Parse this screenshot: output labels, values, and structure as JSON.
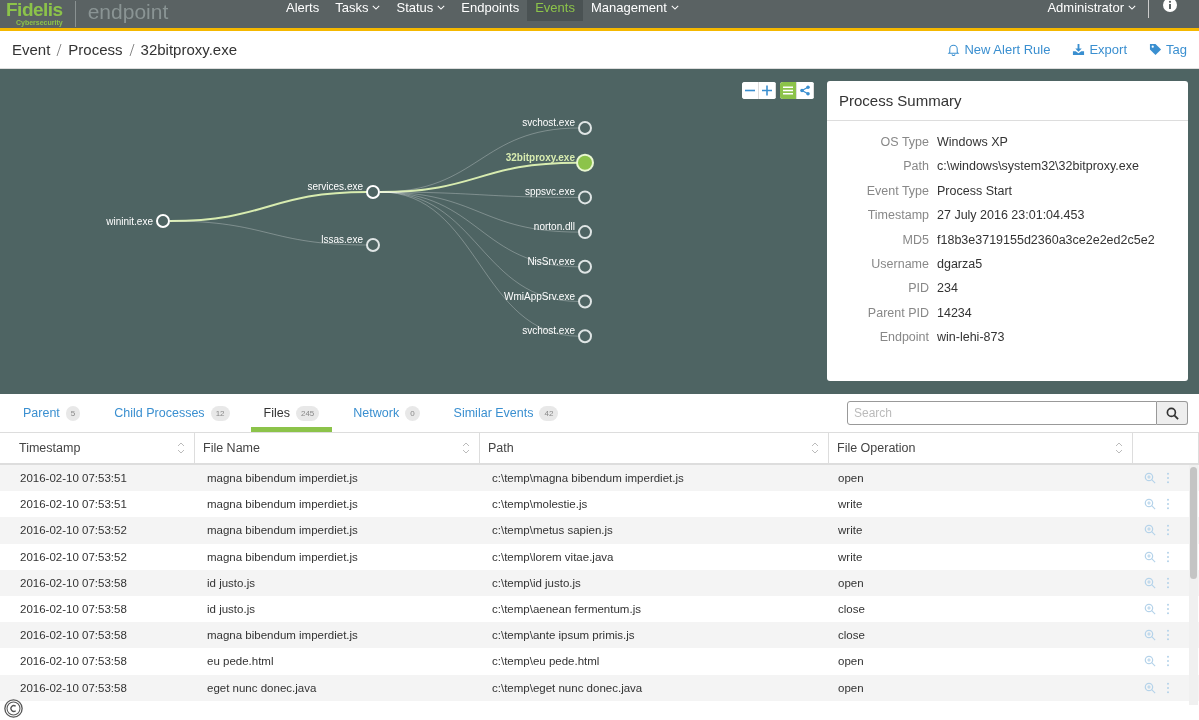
{
  "header": {
    "logo": {
      "name": "Fidelis",
      "tagline": "Cybersecurity",
      "product": "endpoint"
    },
    "nav": [
      {
        "label": "Alerts",
        "dropdown": false,
        "selected": false
      },
      {
        "label": "Tasks",
        "dropdown": true,
        "selected": false
      },
      {
        "label": "Status",
        "dropdown": true,
        "selected": false
      },
      {
        "label": "Endpoints",
        "dropdown": false,
        "selected": false
      },
      {
        "label": "Events",
        "dropdown": false,
        "selected": true
      },
      {
        "label": "Management",
        "dropdown": true,
        "selected": false
      }
    ],
    "user": "Administrator"
  },
  "breadcrumb": [
    "Event",
    "Process",
    "32bitproxy.exe"
  ],
  "actions": [
    {
      "kind": "bell",
      "label": "New Alert Rule"
    },
    {
      "kind": "download",
      "label": "Export"
    },
    {
      "kind": "tag",
      "label": "Tag"
    }
  ],
  "graph": {
    "root": {
      "label": "wininit.exe",
      "selected": false,
      "children": [
        {
          "label": "services.exe",
          "selected": false,
          "children": [
            {
              "label": "svchost.exe",
              "selected": false
            },
            {
              "label": "32bitproxy.exe",
              "selected": true
            },
            {
              "label": "sppsvc.exe",
              "selected": false
            },
            {
              "label": "norton.dll",
              "selected": false
            },
            {
              "label": "NisSrv.exe",
              "selected": false
            },
            {
              "label": "WmiAppSrv.exe",
              "selected": false
            },
            {
              "label": "svchost.exe",
              "selected": false
            }
          ]
        },
        {
          "label": "lssas.exe",
          "selected": false
        }
      ]
    }
  },
  "summary": {
    "title": "Process Summary",
    "fields": [
      {
        "label": "OS Type",
        "value": "Windows XP"
      },
      {
        "label": "Path",
        "value": "c:\\windows\\system32\\32bitproxy.exe"
      },
      {
        "label": "Event Type",
        "value": "Process Start"
      },
      {
        "label": "Timestamp",
        "value": "27 July 2016 23:01:04.453"
      },
      {
        "label": "MD5",
        "value": "f18b3e3719155d2360a3ce2e2ed2c5e2"
      },
      {
        "label": "Username",
        "value": "dgarza5"
      },
      {
        "label": "PID",
        "value": "234"
      },
      {
        "label": "Parent PID",
        "value": "14234"
      },
      {
        "label": "Endpoint",
        "value": "win-lehi-873"
      }
    ]
  },
  "tabs": [
    {
      "label": "Parent",
      "count": "5",
      "selected": false
    },
    {
      "label": "Child Processes",
      "count": "12",
      "selected": false
    },
    {
      "label": "Files",
      "count": "245",
      "selected": true
    },
    {
      "label": "Network",
      "count": "0",
      "selected": false
    },
    {
      "label": "Similar Events",
      "count": "42",
      "selected": false
    }
  ],
  "search": {
    "placeholder": "Search"
  },
  "table": {
    "columns": [
      "Timestamp",
      "File Name",
      "Path",
      "File Operation"
    ],
    "rows": [
      [
        "2016-02-10 07:53:51",
        "magna bibendum imperdiet.js",
        "c:\\temp\\magna bibendum imperdiet.js",
        "open"
      ],
      [
        "2016-02-10 07:53:51",
        "magna bibendum imperdiet.js",
        "c:\\temp\\molestie.js",
        "write"
      ],
      [
        "2016-02-10 07:53:52",
        "magna bibendum imperdiet.js",
        "c:\\temp\\metus sapien.js",
        "write"
      ],
      [
        "2016-02-10 07:53:52",
        "magna bibendum imperdiet.js",
        "c:\\temp\\lorem vitae.java",
        "write"
      ],
      [
        "2016-02-10 07:53:58",
        "id justo.js",
        "c:\\temp\\id justo.js",
        "open"
      ],
      [
        "2016-02-10 07:53:58",
        "id justo.js",
        "c:\\temp\\aenean fermentum.js",
        "close"
      ],
      [
        "2016-02-10 07:53:58",
        "magna bibendum imperdiet.js",
        "c:\\temp\\ante ipsum primis.js",
        "close"
      ],
      [
        "2016-02-10 07:53:58",
        "eu pede.html",
        "c:\\temp\\eu pede.html",
        "open"
      ],
      [
        "2016-02-10 07:53:58",
        "eget nunc donec.java",
        "c:\\temp\\eget nunc donec.java",
        "open"
      ]
    ]
  }
}
